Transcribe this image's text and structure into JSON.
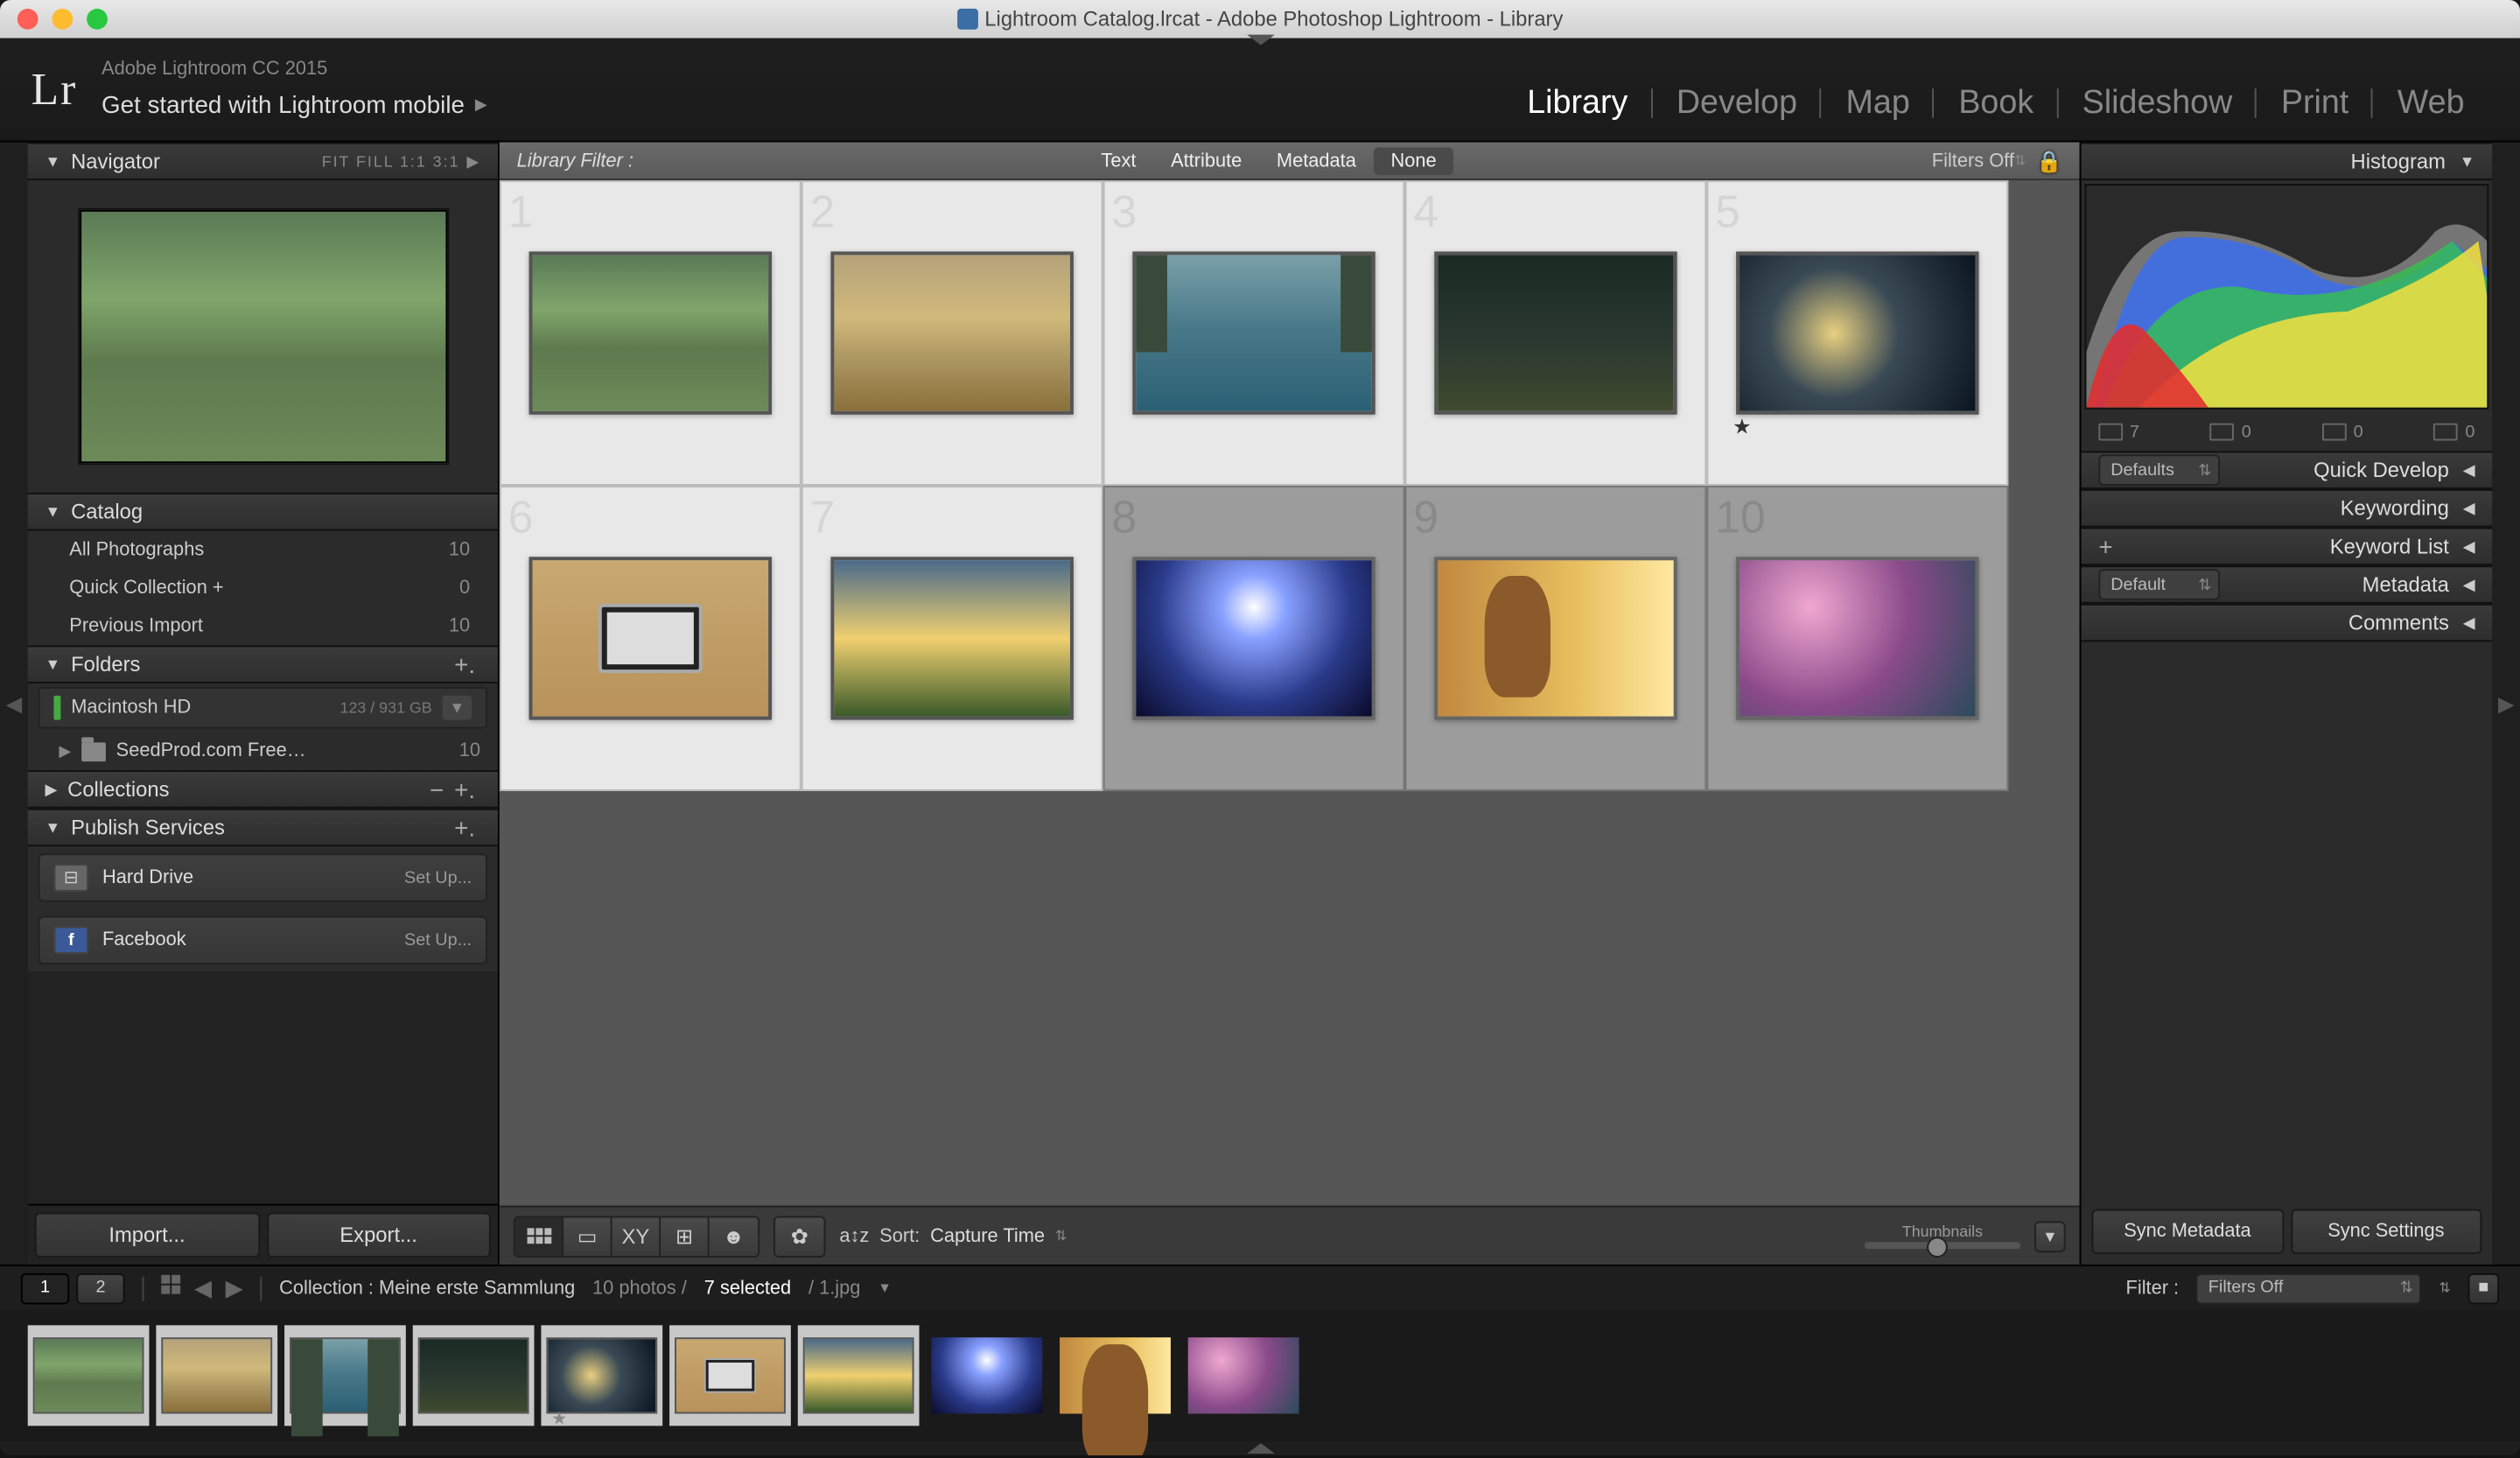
{
  "window_title": "Lightroom Catalog.lrcat - Adobe Photoshop Lightroom - Library",
  "brand": {
    "logo": "Lr",
    "line1": "Adobe Lightroom CC 2015",
    "line2": "Get started with Lightroom mobile"
  },
  "modules": {
    "library": "Library",
    "develop": "Develop",
    "map": "Map",
    "book": "Book",
    "slideshow": "Slideshow",
    "print": "Print",
    "web": "Web"
  },
  "left": {
    "navigator": {
      "title": "Navigator",
      "opts": "FIT   FILL   1:1   3:1"
    },
    "catalog": {
      "title": "Catalog",
      "rows": [
        {
          "label": "All Photographs",
          "count": "10"
        },
        {
          "label": "Quick Collection  +",
          "count": "0"
        },
        {
          "label": "Previous Import",
          "count": "10"
        }
      ]
    },
    "folders": {
      "title": "Folders",
      "volume": {
        "name": "Macintosh HD",
        "space": "123 / 931 GB"
      },
      "sub": {
        "name": "SeedProd.com Free…",
        "count": "10"
      }
    },
    "collections": {
      "title": "Collections"
    },
    "publish": {
      "title": "Publish Services",
      "rows": [
        {
          "icon": "hd",
          "label": "Hard Drive",
          "action": "Set Up..."
        },
        {
          "icon": "fb",
          "label": "Facebook",
          "action": "Set Up..."
        }
      ]
    },
    "import_btn": "Import...",
    "export_btn": "Export..."
  },
  "center": {
    "filter_label": "Library Filter :",
    "tabs": {
      "text": "Text",
      "attribute": "Attribute",
      "metadata": "Metadata",
      "none": "None"
    },
    "filters_off": "Filters Off",
    "sort_label": "Sort:",
    "sort_value": "Capture Time",
    "thumbnails_label": "Thumbnails",
    "cells": [
      "1",
      "2",
      "3",
      "4",
      "5",
      "6",
      "7",
      "8",
      "9",
      "10"
    ],
    "selected": [
      true,
      true,
      true,
      true,
      true,
      true,
      true,
      false,
      false,
      false
    ],
    "starred_index": 4
  },
  "right": {
    "histogram": "Histogram",
    "hist_counts": {
      "a": "7",
      "b": "0",
      "c": "0",
      "d": "0"
    },
    "defaults": "Defaults",
    "quickdev": "Quick Develop",
    "keywording": "Keywording",
    "keywordlist": "Keyword List",
    "metadata": "Metadata",
    "metadata_preset": "Default",
    "comments": "Comments",
    "sync_meta": "Sync Metadata",
    "sync_settings": "Sync Settings"
  },
  "status": {
    "page1": "1",
    "page2": "2",
    "collection": "Collection : Meine erste Sammlung",
    "count": "10 photos /",
    "selected": "7 selected",
    "file": "/ 1.jpg",
    "filter_label": "Filter :",
    "filter_value": "Filters Off"
  }
}
